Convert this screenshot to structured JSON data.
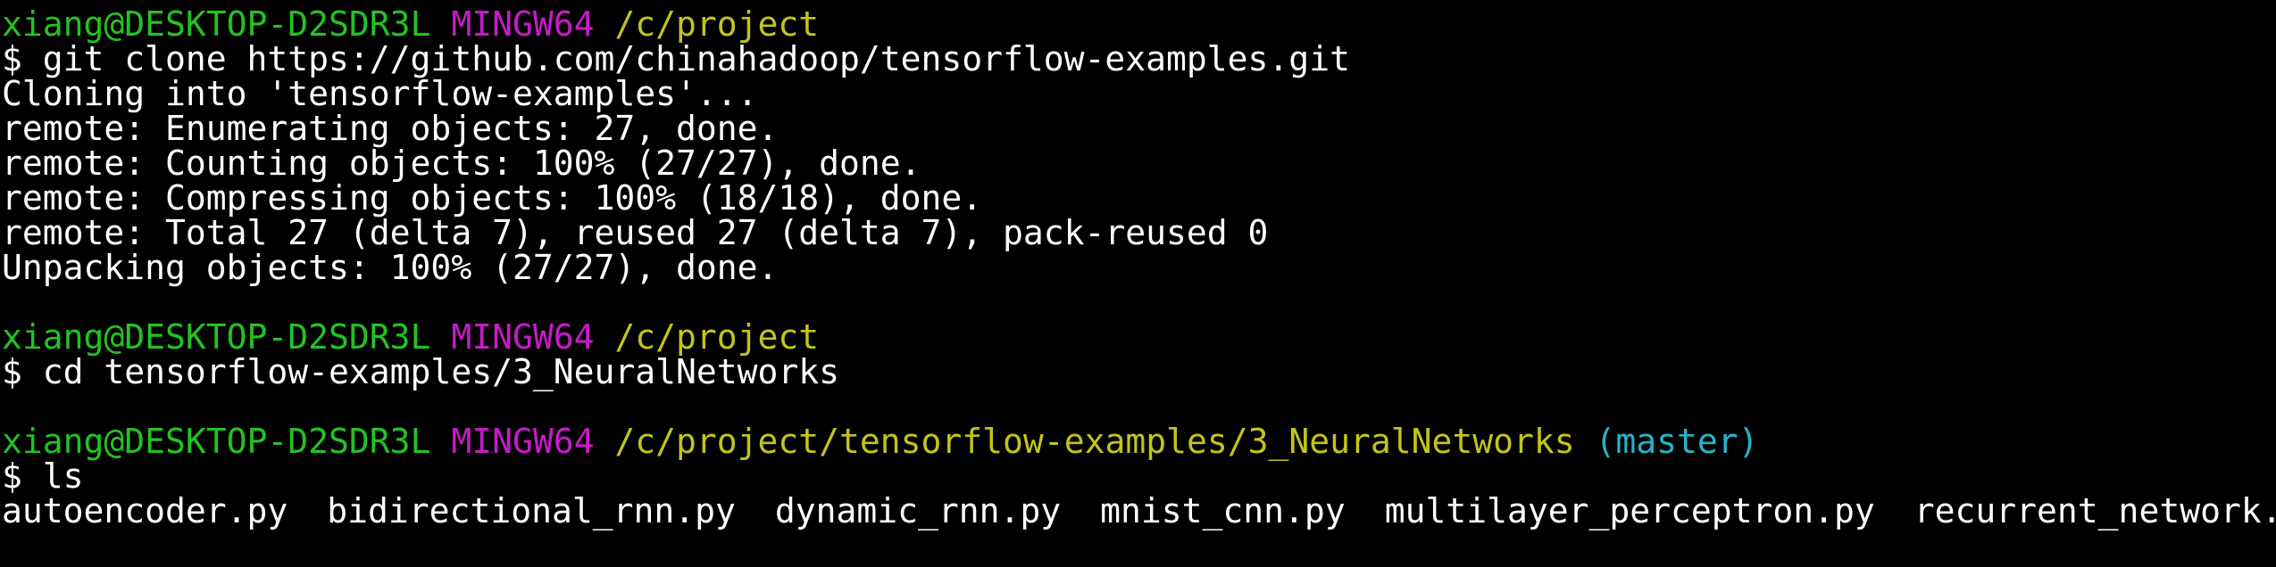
{
  "colors": {
    "background": "#000000",
    "text": "#ffffff",
    "user": "#22c322",
    "system": "#c71bc7",
    "path": "#c4c41a",
    "branch": "#25b4c8"
  },
  "block1": {
    "user": "xiang@DESKTOP-D2SDR3L",
    "system": "MINGW64",
    "path": "/c/project",
    "command": "$ git clone https://github.com/chinahadoop/tensorflow-examples.git",
    "output": [
      "Cloning into 'tensorflow-examples'...",
      "remote: Enumerating objects: 27, done.",
      "remote: Counting objects: 100% (27/27), done.",
      "remote: Compressing objects: 100% (18/18), done.",
      "remote: Total 27 (delta 7), reused 27 (delta 7), pack-reused 0",
      "Unpacking objects: 100% (27/27), done."
    ]
  },
  "block2": {
    "user": "xiang@DESKTOP-D2SDR3L",
    "system": "MINGW64",
    "path": "/c/project",
    "command": "$ cd tensorflow-examples/3_NeuralNetworks"
  },
  "block3": {
    "user": "xiang@DESKTOP-D2SDR3L",
    "system": "MINGW64",
    "path": "/c/project/tensorflow-examples/3_NeuralNetworks",
    "branch": "(master)",
    "command": "$ ls",
    "files": [
      "autoencoder.py",
      "bidirectional_rnn.py",
      "dynamic_rnn.py",
      "mnist_cnn.py",
      "multilayer_perceptron.py",
      "recurrent_network.py"
    ]
  }
}
